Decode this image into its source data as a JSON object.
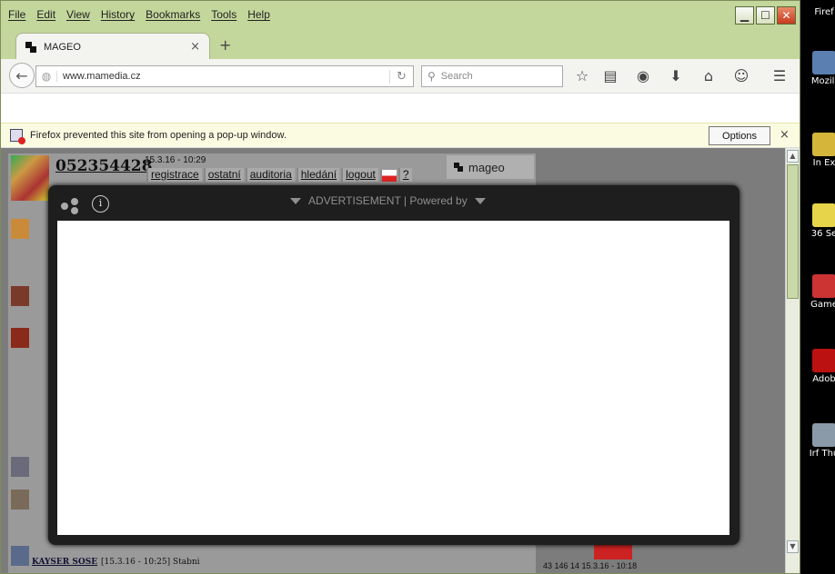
{
  "menu": [
    "File",
    "Edit",
    "View",
    "History",
    "Bookmarks",
    "Tools",
    "Help"
  ],
  "tab": {
    "title": "MAGEO",
    "close": "×",
    "new": "+"
  },
  "navbar": {
    "url": "www.mamedia.cz",
    "search_placeholder": "Search"
  },
  "notification": {
    "text": "Firefox prevented this site from opening a pop-up window.",
    "options_label": "Options",
    "close": "×"
  },
  "site": {
    "counter": "052354428",
    "datetime": "15.3.16 - 10:29",
    "nav": [
      "registrace",
      "ostatní",
      "auditoria",
      "hledání",
      "logout",
      "?"
    ],
    "brand": "mageo",
    "post_name": "KAYSER SOSE",
    "post_time": "[15.3.16 - 10:25] Stabni",
    "stamp": "43 146 14 15.3.16 - 10:18"
  },
  "ad": {
    "label": "ADVERTISEMENT | Powered by",
    "info": "i"
  },
  "desktop": [
    "Firef",
    "Mozill",
    "In Ex",
    "36 Se",
    "Game",
    "Adob",
    "Irf Thu"
  ],
  "colors": {
    "window_frame": "#c3d69b",
    "ad_bg": "#1e1e1e",
    "notif_bg": "#fbfbe2"
  }
}
